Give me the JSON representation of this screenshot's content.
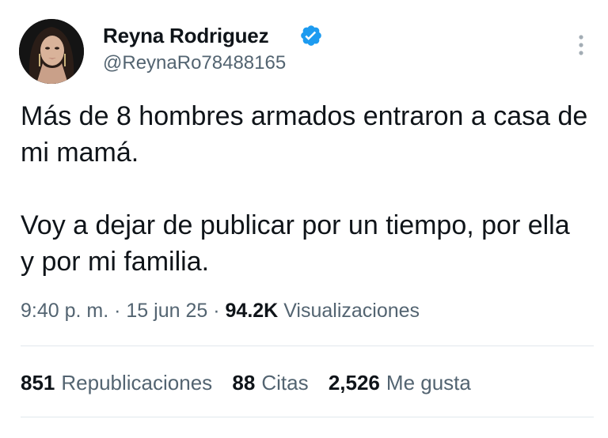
{
  "user": {
    "display_name": "Reyna Rodriguez",
    "handle": "@ReynaRo78488165",
    "verified": true,
    "verified_color": "#1d9bf0"
  },
  "tweet": {
    "paragraphs": [
      "Más de 8 hombres armados entraron a casa de mi mamá.",
      "Voy a dejar de publicar por un tiempo, por ella y por mi familia."
    ]
  },
  "meta": {
    "time": "9:40 p. m.",
    "separator": "·",
    "date": "15 jun 25",
    "views_count": "94.2K",
    "views_label": "Visualizaciones"
  },
  "stats": [
    {
      "count": "851",
      "label": "Republicaciones"
    },
    {
      "count": "88",
      "label": "Citas"
    },
    {
      "count": "2,526",
      "label": "Me gusta"
    }
  ],
  "icons": {
    "more": "more-vertical-icon",
    "verified": "verified-badge-icon"
  }
}
